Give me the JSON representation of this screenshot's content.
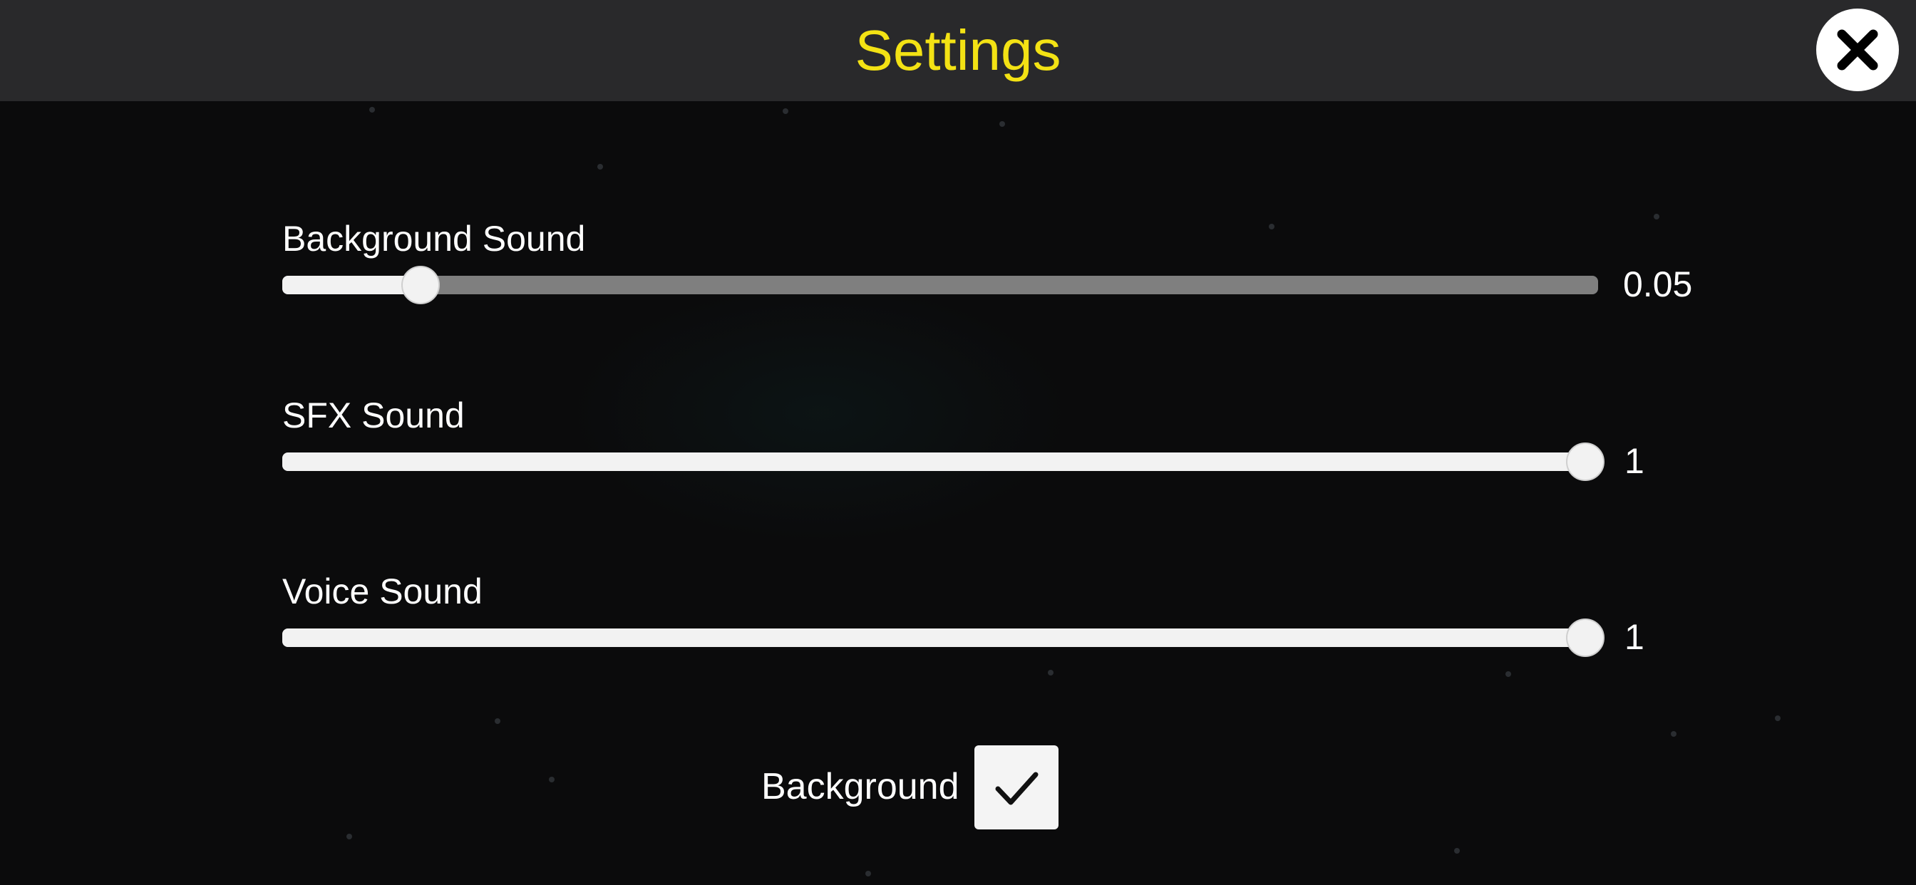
{
  "header": {
    "title": "Settings",
    "close_icon": "close-icon"
  },
  "sliders": [
    {
      "label": "Background Sound",
      "value": 0.05,
      "value_text": "0.05"
    },
    {
      "label": "SFX Sound",
      "value": 1,
      "value_text": "1"
    },
    {
      "label": "Voice Sound",
      "value": 1,
      "value_text": "1"
    }
  ],
  "background_toggle": {
    "label": "Background",
    "checked": true,
    "icon": "checkmark-icon"
  },
  "colors": {
    "title": "#f3e214",
    "header_bg": "#29292b",
    "track_empty": "#7f7f7f",
    "track_fill": "#f2f2f2"
  }
}
